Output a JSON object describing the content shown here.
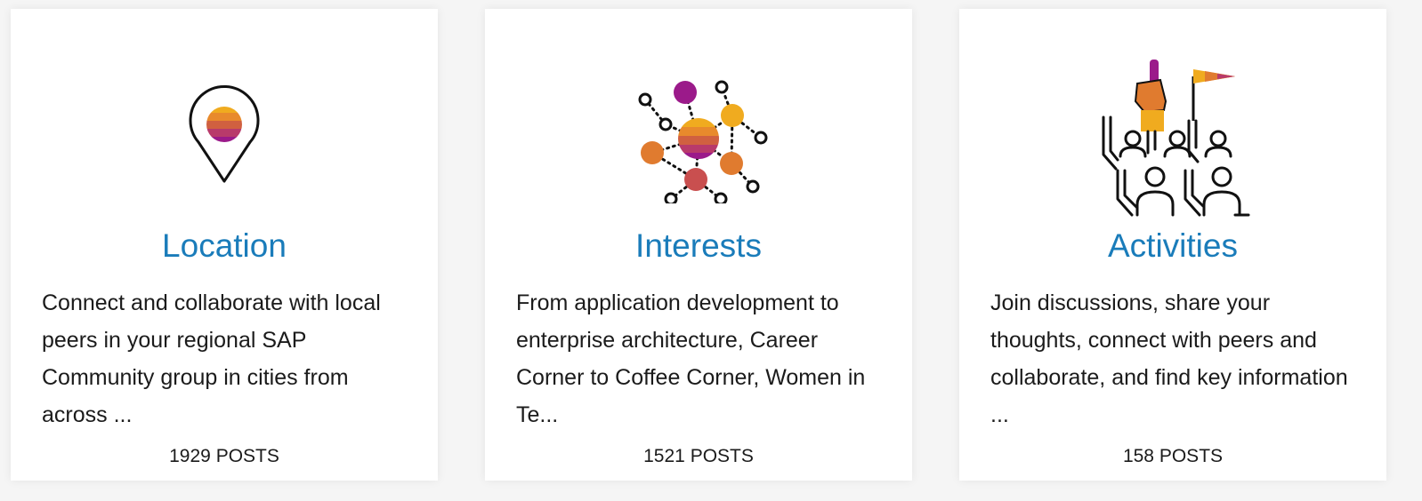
{
  "colors": {
    "title": "#1a7cba",
    "text": "#1b1b1b",
    "card_bg": "#ffffff",
    "page_bg": "#f5f5f5",
    "accent_purple": "#9b1a8a",
    "accent_orange": "#e07b2f",
    "accent_yellow": "#f0ab1f",
    "accent_red": "#c94f4f"
  },
  "cards": [
    {
      "icon": "location-pin-icon",
      "title": "Location",
      "description": "Connect and collaborate with local peers in your regional SAP Community group in cities from across ...",
      "posts_count": "1929",
      "posts_label": "POSTS"
    },
    {
      "icon": "network-interests-icon",
      "title": "Interests",
      "description": "From application development to enterprise architecture, Career Corner to Coffee Corner, Women in Te...",
      "posts_count": "1521",
      "posts_label": "POSTS"
    },
    {
      "icon": "crowd-activities-icon",
      "title": "Activities",
      "description": "Join discussions, share your thoughts, connect with peers and collaborate, and find key information ...",
      "posts_count": "158",
      "posts_label": "POSTS"
    }
  ]
}
